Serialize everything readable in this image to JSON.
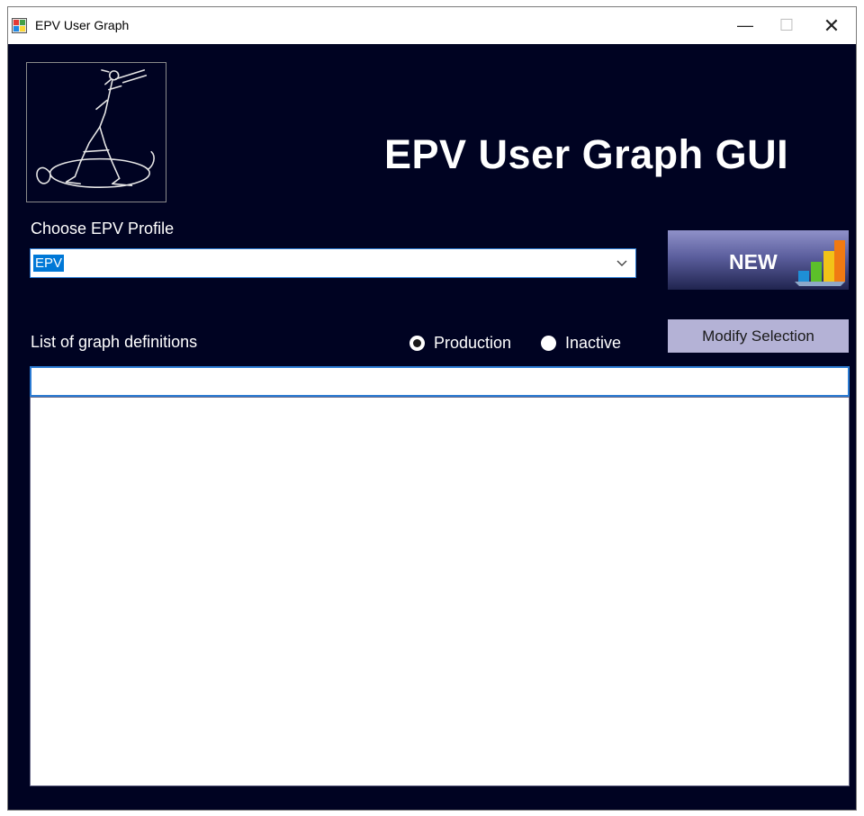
{
  "window": {
    "title": "EPV User Graph",
    "minimize_glyph": "—",
    "maximize_glyph": "☐",
    "close_glyph": "✕"
  },
  "header": {
    "app_title": "EPV User Graph GUI"
  },
  "profile": {
    "label": "Choose EPV Profile",
    "selected_value": "EPV"
  },
  "new_button": {
    "label": "NEW"
  },
  "graph_definitions": {
    "label": "List of graph definitions",
    "filter_value": "",
    "items": []
  },
  "status_filter": {
    "options": [
      {
        "label": "Production",
        "checked": true
      },
      {
        "label": "Inactive",
        "checked": false
      }
    ]
  },
  "modify_button": {
    "label": "Modify Selection"
  },
  "colors": {
    "background": "#000322",
    "accent": "#2b7bd3",
    "modify_button": "#b4b2d6"
  },
  "icons": {
    "app": "app-window-icon",
    "logo": "piper-figure-logo",
    "new_button": "bar-chart-icon"
  }
}
